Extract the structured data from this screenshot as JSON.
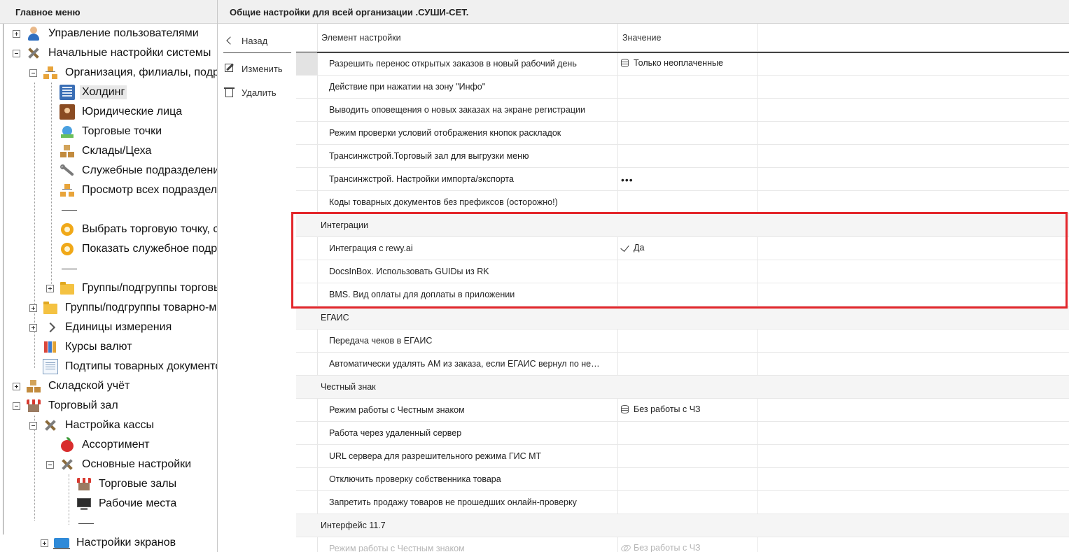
{
  "sidebar": {
    "title": "Главное меню",
    "items": [
      {
        "label": "Управление пользователями",
        "icon": "user-icon"
      },
      {
        "label": "Начальные настройки системы",
        "icon": "tools-icon"
      },
      {
        "label": "Организация, филиалы, подра",
        "icon": "org-structure-icon"
      },
      {
        "label": "Холдинг",
        "icon": "building-icon"
      },
      {
        "label": "Юридические лица",
        "icon": "contacts-book-icon"
      },
      {
        "label": "Торговые точки",
        "icon": "globe-icon"
      },
      {
        "label": "Склады/Цеха",
        "icon": "boxes-icon"
      },
      {
        "label": "Служебные подразделени",
        "icon": "wrench-icon"
      },
      {
        "label": "Просмотр всех подраздел",
        "icon": "org-structure-icon"
      },
      {
        "label": "Выбрать торговую точку, с",
        "icon": "gear-icon"
      },
      {
        "label": "Показать служебное подра",
        "icon": "gear-icon"
      },
      {
        "label": "Группы/подгруппы торговы",
        "icon": "folder-icon"
      },
      {
        "label": "Группы/подгруппы товарно-ма",
        "icon": "folder-icon"
      },
      {
        "label": "Единицы измерения",
        "icon": "chevron-right-icon"
      },
      {
        "label": "Курсы валют",
        "icon": "currency-books-icon"
      },
      {
        "label": "Подтипы товарных документо",
        "icon": "document-icon"
      },
      {
        "label": "Складской учёт",
        "icon": "boxes-icon"
      },
      {
        "label": "Торговый зал",
        "icon": "shop-icon"
      },
      {
        "label": "Настройка кассы",
        "icon": "tools-icon"
      },
      {
        "label": "Ассортимент",
        "icon": "apple-icon"
      },
      {
        "label": "Основные настройки",
        "icon": "tools-icon"
      },
      {
        "label": "Торговые залы",
        "icon": "shop-icon"
      },
      {
        "label": "Рабочие места",
        "icon": "monitor-icon"
      },
      {
        "label": "Настройки экранов",
        "icon": "screen-icon"
      }
    ]
  },
  "header": {
    "title": "Общие настройки для всей организации .СУШИ-СЕТ."
  },
  "actions": {
    "back": "Назад",
    "edit": "Изменить",
    "delete": "Удалить"
  },
  "grid": {
    "columns": {
      "name": "Элемент настройки",
      "value": "Значение"
    },
    "rows": [
      {
        "name": "Разрешить перенос открытых заказов в новый рабочий день",
        "value": "Только неоплаченные"
      },
      {
        "name": "Действие при нажатии на зону \"Инфо\"",
        "value": ""
      },
      {
        "name": "Выводить оповещения о новых заказах на экране регистрации",
        "value": ""
      },
      {
        "name": "Режим проверки условий отображения кнопок раскладок",
        "value": ""
      },
      {
        "name": "Трансинжстрой.Торговый зал для выгрузки меню",
        "value": ""
      },
      {
        "name": "Трансинжстрой. Настройки импорта/экспорта",
        "value": "•••"
      },
      {
        "name": "Коды товарных документов без префиксов (осторожно!)",
        "value": ""
      },
      {
        "name": "Интеграции",
        "value": ""
      },
      {
        "name": "Интеграция с rewy.ai",
        "value": "Да"
      },
      {
        "name": "DocsInBox. Использовать GUIDы из RK",
        "value": ""
      },
      {
        "name": "BMS. Вид оплаты для доплаты в приложении",
        "value": ""
      },
      {
        "name": "ЕГАИС",
        "value": ""
      },
      {
        "name": "Передача чеков в ЕГАИС",
        "value": ""
      },
      {
        "name": "Автоматически удалять АМ из заказа, если ЕГАИС вернул по не…",
        "value": ""
      },
      {
        "name": "Честный знак",
        "value": ""
      },
      {
        "name": "Режим работы с Честным знаком",
        "value": "Без работы с ЧЗ"
      },
      {
        "name": "Работа через удаленный сервер",
        "value": ""
      },
      {
        "name": "URL сервера для разрешительного режима ГИС МТ",
        "value": ""
      },
      {
        "name": "Отключить проверку собственника товара",
        "value": ""
      },
      {
        "name": "Запретить продажу товаров не прошедших онлайн-проверку",
        "value": ""
      },
      {
        "name": "Интерфейс 11.7",
        "value": ""
      },
      {
        "name": "Режим работы с Честным знаком",
        "value": "Без работы с ЧЗ"
      }
    ]
  },
  "colors": {
    "highlight": "#e3262b",
    "group_row_bg": "#f5f5f5",
    "header_bg": "#f0f0f0"
  }
}
